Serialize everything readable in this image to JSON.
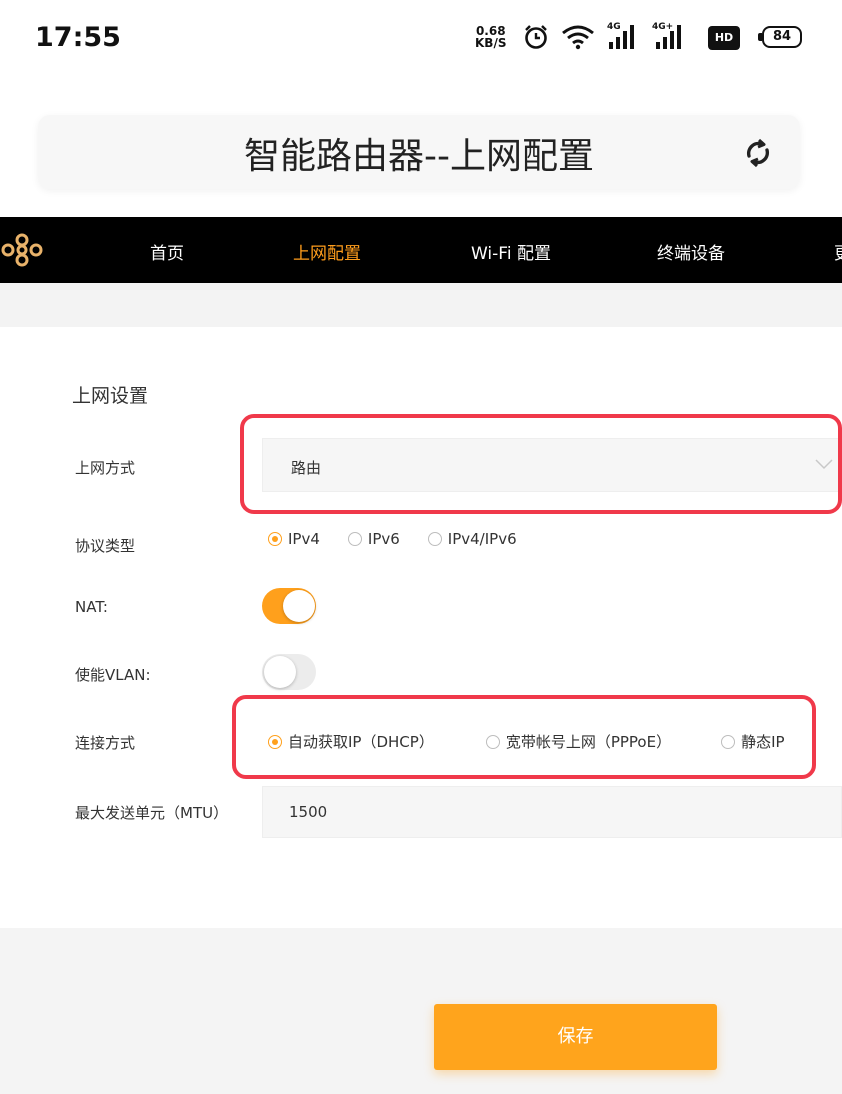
{
  "status_bar": {
    "time": "17:55",
    "net_speed_value": "0.68",
    "net_speed_unit": "KB/S",
    "signal1_label": "4G",
    "signal2_label": "4G+",
    "hd_label": "HD",
    "battery": "84",
    "icons": [
      "alarm-icon",
      "wifi-icon",
      "signal-icon",
      "hd-icon",
      "battery-icon"
    ]
  },
  "header": {
    "title": "智能路由器--上网配置",
    "refresh_icon": "refresh-icon"
  },
  "nav": {
    "items": [
      {
        "label": "首页"
      },
      {
        "label": "上网配置"
      },
      {
        "label": "Wi-Fi 配置"
      },
      {
        "label": "终端设备"
      },
      {
        "label": "更"
      }
    ],
    "active_index": 1
  },
  "form": {
    "section_title": "上网设置",
    "access_mode": {
      "label": "上网方式",
      "value": "路由"
    },
    "protocol": {
      "label": "协议类型",
      "options": [
        "IPv4",
        "IPv6",
        "IPv4/IPv6"
      ],
      "selected": "IPv4"
    },
    "nat": {
      "label": "NAT:",
      "enabled": true
    },
    "vlan": {
      "label": "使能VLAN:",
      "enabled": false
    },
    "connection": {
      "label": "连接方式",
      "options": [
        "自动获取IP（DHCP）",
        "宽带帐号上网（PPPoE）",
        "静态IP"
      ],
      "selected": "自动获取IP（DHCP）"
    },
    "mtu": {
      "label": "最大发送单元（MTU）",
      "value": "1500"
    }
  },
  "save_label": "保存",
  "colors": {
    "accent": "#ffa41c",
    "nav_background": "#000000",
    "highlight_border": "#f0394a"
  }
}
